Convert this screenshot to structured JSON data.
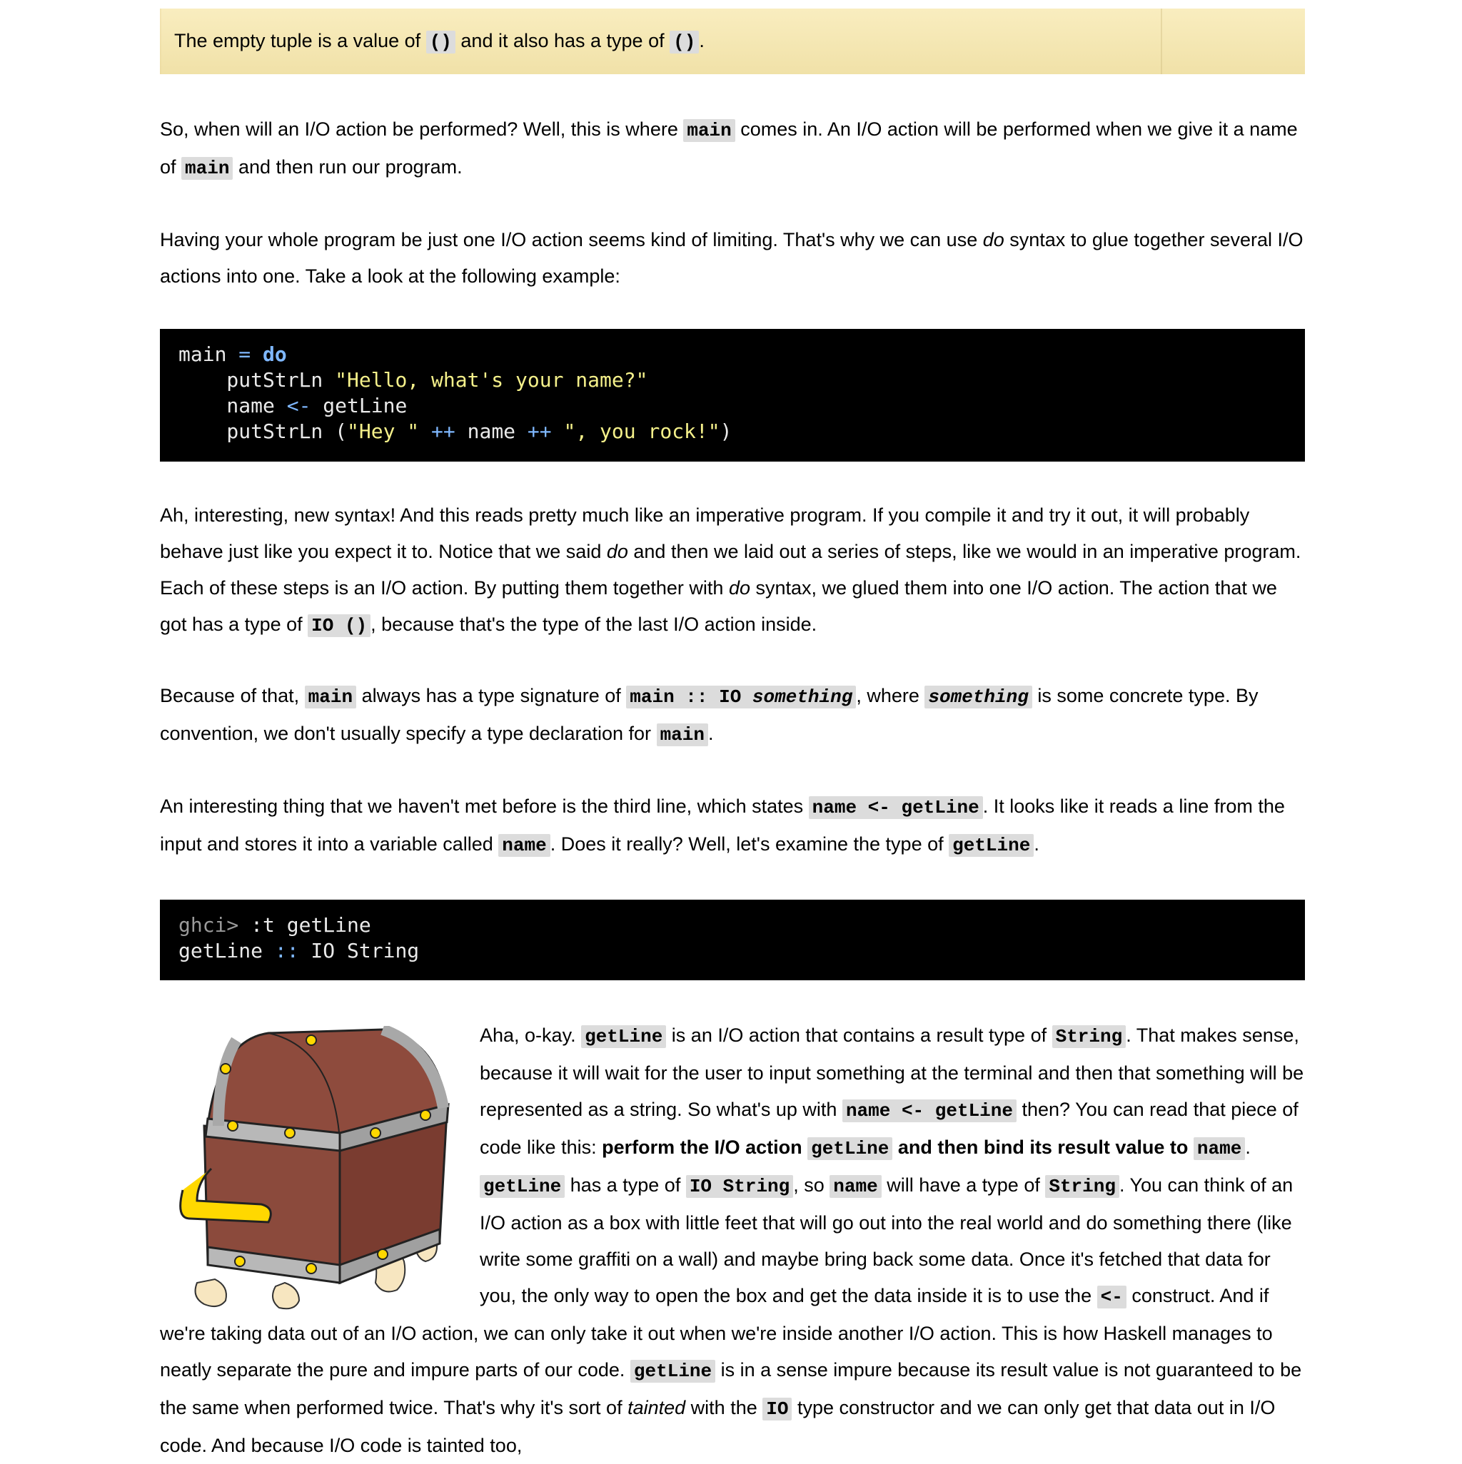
{
  "hint": {
    "t1": "The empty tuple is a value of ",
    "c1": "()",
    "t2": " and it also has a type of ",
    "c2": "()",
    "t3": "."
  },
  "p1": {
    "t1": "So, when will an I/O action be performed? Well, this is where ",
    "c1": "main",
    "t2": " comes in. An I/O action will be performed when we give it a name of ",
    "c2": "main",
    "t3": " and then run our program."
  },
  "p2": {
    "t1": "Having your whole program be just one I/O action seems kind of limiting. That's why we can use ",
    "em1": "do",
    "t2": " syntax to glue together several I/O actions into one. Take a look at the following example:"
  },
  "code1": {
    "l1_a": "main ",
    "l1_op": "=",
    "l1_sp": " ",
    "l1_kw": "do",
    "l2_a": "    putStrLn ",
    "l2_s": "\"Hello, what's your name?\"",
    "l3_a": "    name ",
    "l3_op": "<-",
    "l3_b": " getLine",
    "l4_a": "    putStrLn (",
    "l4_s1": "\"Hey \"",
    "l4_sp1": " ",
    "l4_op1": "++",
    "l4_b": " name ",
    "l4_op2": "++",
    "l4_sp2": " ",
    "l4_s2": "\", you rock!\"",
    "l4_c": ")"
  },
  "p3": {
    "t1": "Ah, interesting, new syntax! And this reads pretty much like an imperative program. If you compile it and try it out, it will probably behave just like you expect it to. Notice that we said ",
    "em1": "do",
    "t2": " and then we laid out a series of steps, like we would in an imperative program. Each of these steps is an I/O action. By putting them together with ",
    "em2": "do",
    "t3": " syntax, we glued them into one I/O action. The action that we got has a type of ",
    "c1": "IO ()",
    "t4": ", because that's the type of the last I/O action inside."
  },
  "p4": {
    "t1": "Because of that, ",
    "c1": "main",
    "t2": " always has a type signature of ",
    "c2a": "main :: IO ",
    "c2b": "something",
    "t3": ", where ",
    "c3": "something",
    "t4": " is some concrete type. By convention, we don't usually specify a type declaration for ",
    "c4": "main",
    "t5": "."
  },
  "p5": {
    "t1": "An interesting thing that we haven't met before is the third line, which states ",
    "c1": "name <- getLine",
    "t2": ". It looks like it reads a line from the input and stores it into a variable called ",
    "c2": "name",
    "t3": ". Does it really? Well, let's examine the type of ",
    "c3": "getLine",
    "t4": "."
  },
  "code2": {
    "l1_p": "ghci>",
    "l1_a": " :t getLine",
    "l2_a": "getLine ",
    "l2_op": "::",
    "l2_b": " IO String"
  },
  "p6": {
    "t1": "Aha, o-kay. ",
    "c1": "getLine",
    "t2": " is an I/O action that contains a result type of ",
    "c2": "String",
    "t3": ". That makes sense, because it will wait for the user to input something at the terminal and then that something will be represented as a string. So what's up with ",
    "c3": "name <- getLine",
    "t4": " then? You can read that piece of code like this: ",
    "b1": "perform the I/O action ",
    "c4": "getLine",
    "b2": " and then bind its result value to ",
    "c5": "name",
    "t5": ". ",
    "c6": "getLine",
    "t6": " has a type of ",
    "c7": "IO String",
    "t7": ", so ",
    "c8": "name",
    "t8": " will have a type of ",
    "c9": "String",
    "t9": ". You can think of an I/O action as a box with little feet that will go out into the real world and do something there (like write some graffiti on a wall) and maybe bring back some data. Once it's fetched that data for you, the only way to open the box and get the data inside it is to use the ",
    "c10": "<-",
    "t10": " construct. And if we're taking data out of an I/O action, we can only take it out when we're inside another I/O action. This is how Haskell manages to neatly separate the pure and impure parts of our code. ",
    "c11": "getLine",
    "t11": " is in a sense impure because its result value is not guaranteed to be the same when performed twice. That's why it's sort of ",
    "em1": "tainted",
    "t12": " with the ",
    "c12": "IO",
    "t13": " type constructor and we can only get that data out in I/O code. And because I/O code is tainted too,"
  },
  "colors": {
    "hint_bg": "#f8eab4",
    "code_bg": "#000000",
    "code_keyword": "#7fb8ff",
    "code_string": "#f4f08a",
    "inline_code_bg": "#dcdcdc"
  },
  "icons": {
    "chest": "treasure-chest-with-feet-illustration"
  }
}
